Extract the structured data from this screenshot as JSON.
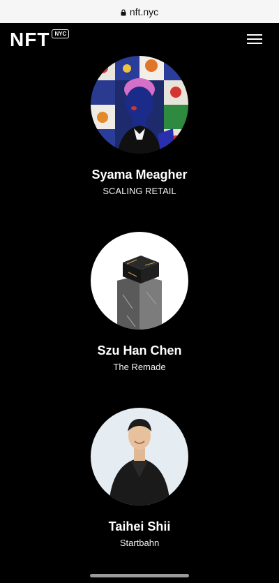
{
  "browser": {
    "url": "nft.nyc"
  },
  "header": {
    "logo_text": "NFT",
    "logo_badge": "NYC"
  },
  "speakers": [
    {
      "name": "Syama Meagher",
      "company": "SCALING RETAIL"
    },
    {
      "name": "Szu Han Chen",
      "company": "The Remade"
    },
    {
      "name": "Taihei Shii",
      "company": "Startbahn"
    }
  ]
}
